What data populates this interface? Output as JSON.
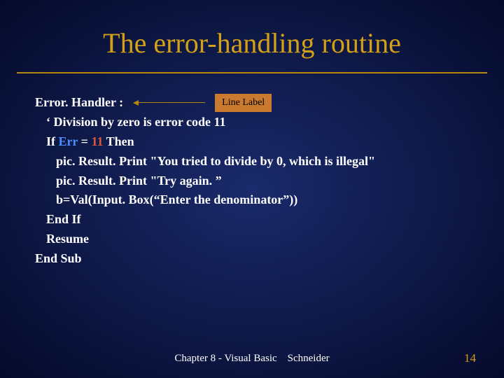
{
  "title": "The error-handling routine",
  "callout": "Line Label",
  "code": {
    "l1": "Error. Handler :",
    "l2": "‘ Division by zero is error code 11",
    "l3_pre": "If ",
    "l3_err": "Err",
    "l3_eq": " = ",
    "l3_eleven": "11",
    "l3_then": " Then",
    "l4": "pic. Result. Print \"You tried to divide by 0, which is illegal\"",
    "l5": "pic. Result. Print \"Try again. ”",
    "l6": "b=Val(Input. Box(“Enter the denominator”))",
    "l7": "End If",
    "l8": "Resume",
    "l9": "End Sub"
  },
  "footer": {
    "center": "Chapter 8 - Visual Basic    Schneider",
    "page": "14"
  }
}
